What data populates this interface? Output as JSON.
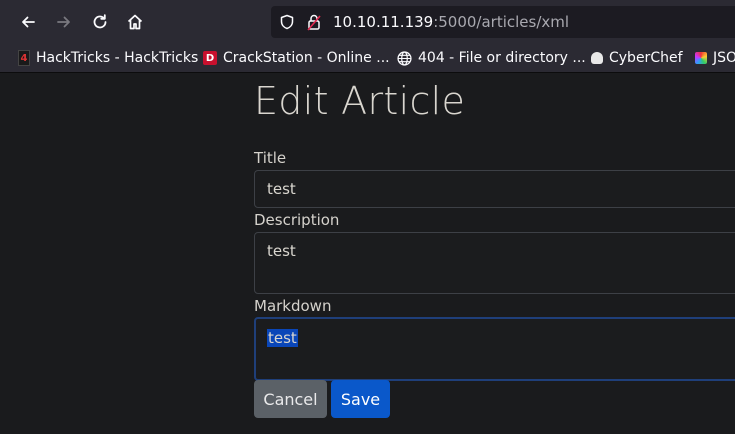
{
  "browser": {
    "url_host": "10.10.11.139",
    "url_rest": ":5000/articles/xml"
  },
  "bookmarks": [
    {
      "label": "HackTricks - HackTricks",
      "icon": "hacktricks-icon"
    },
    {
      "label": "CrackStation - Online ...",
      "icon": "crackstation-icon"
    },
    {
      "label": "404 - File or directory ...",
      "icon": "globe-icon"
    },
    {
      "label": "CyberChef",
      "icon": "cyberchef-icon"
    },
    {
      "label": "JSO",
      "icon": "json-icon"
    }
  ],
  "form": {
    "heading": "Edit Article",
    "title_label": "Title",
    "title_value": "test",
    "description_label": "Description",
    "description_value": "test",
    "markdown_label": "Markdown",
    "markdown_value": "test",
    "cancel_label": "Cancel",
    "save_label": "Save"
  },
  "colors": {
    "accent": "#0a58ca",
    "selection": "#0a46b8"
  }
}
